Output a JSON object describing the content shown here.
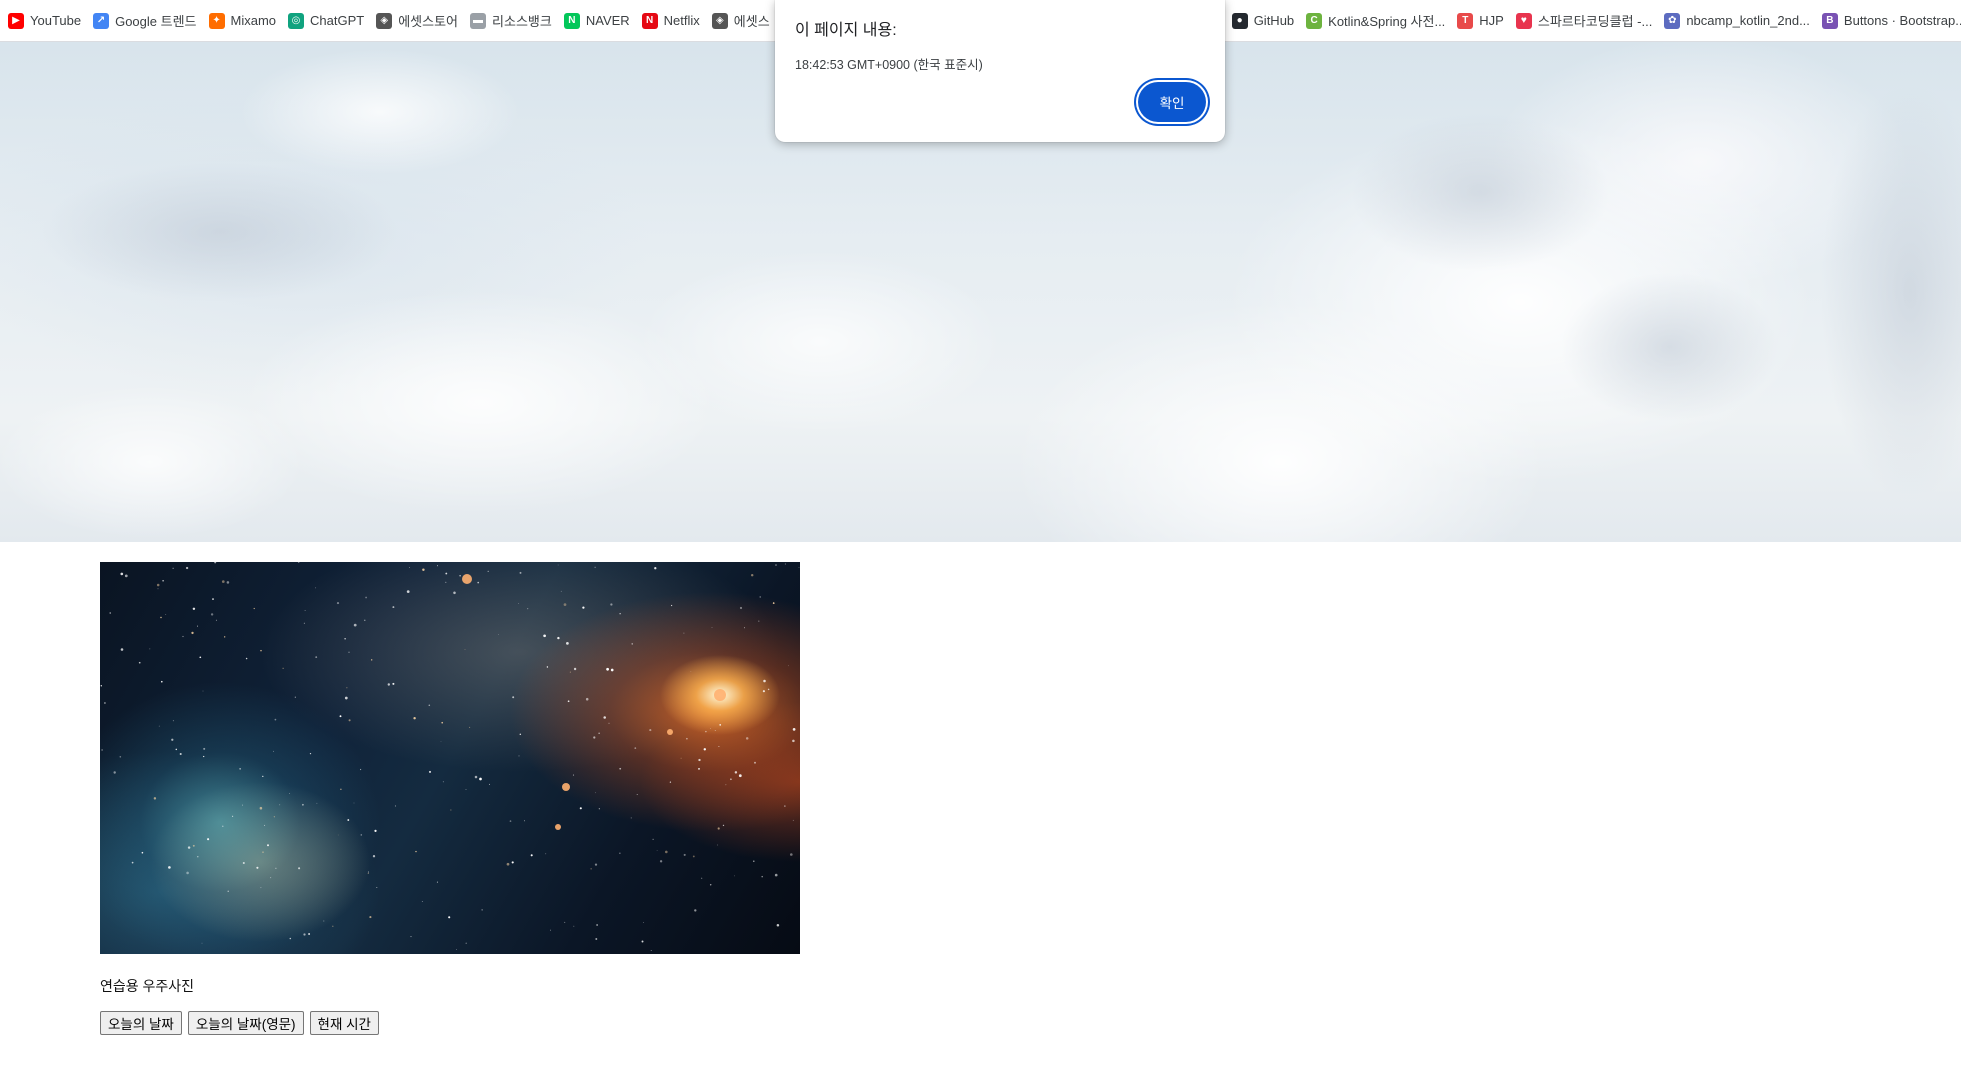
{
  "bookmarks": [
    {
      "label": "YouTube",
      "icon": "youtube-icon",
      "color": "#ff0000",
      "glyph": "▶"
    },
    {
      "label": "Google 트렌드",
      "icon": "trends-icon",
      "color": "#4285f4",
      "glyph": "↗"
    },
    {
      "label": "Mixamo",
      "icon": "mixamo-icon",
      "color": "#ff6d00",
      "glyph": "✦"
    },
    {
      "label": "ChatGPT",
      "icon": "chatgpt-icon",
      "color": "#10a37f",
      "glyph": "◎"
    },
    {
      "label": "에셋스토어",
      "icon": "unity-icon",
      "color": "#555555",
      "glyph": "◈"
    },
    {
      "label": "리소스뱅크",
      "icon": "resourcebank-icon",
      "color": "#9aa0a6",
      "glyph": "▬"
    },
    {
      "label": "NAVER",
      "icon": "naver-icon",
      "color": "#03c75a",
      "glyph": "N"
    },
    {
      "label": "Netflix",
      "icon": "netflix-icon",
      "color": "#e50914",
      "glyph": "N"
    },
    {
      "label": "에셋스",
      "icon": "unity-icon",
      "color": "#555555",
      "glyph": "◈"
    }
  ],
  "bookmarks_right": [
    {
      "label": "GitHub",
      "icon": "github-icon",
      "color": "#24292f",
      "glyph": "●"
    },
    {
      "label": "Kotlin&Spring 사전...",
      "icon": "kotlin-spring-icon",
      "color": "#6db33f",
      "glyph": "C"
    },
    {
      "label": "HJP",
      "icon": "hjp-icon",
      "color": "#e84a4a",
      "glyph": "T"
    },
    {
      "label": "스파르타코딩클럽 -...",
      "icon": "sparta-icon",
      "color": "#e8344e",
      "glyph": "♥"
    },
    {
      "label": "nbcamp_kotlin_2nd...",
      "icon": "nbcamp-icon",
      "color": "#5c6bc0",
      "glyph": "✿"
    },
    {
      "label": "Buttons · Bootstrap...",
      "icon": "bootstrap-icon",
      "color": "#7952b3",
      "glyph": "B"
    }
  ],
  "dialog": {
    "title": "이 페이지 내용:",
    "message": "18:42:53 GMT+0900 (한국 표준시)",
    "ok_label": "확인"
  },
  "page": {
    "caption": "연습용 우주사진",
    "buttons": {
      "today": "오늘의 날짜",
      "today_en": "오늘의 날짜(영문)",
      "now": "현재 시간"
    }
  },
  "colors": {
    "accent": "#0b57d0"
  }
}
